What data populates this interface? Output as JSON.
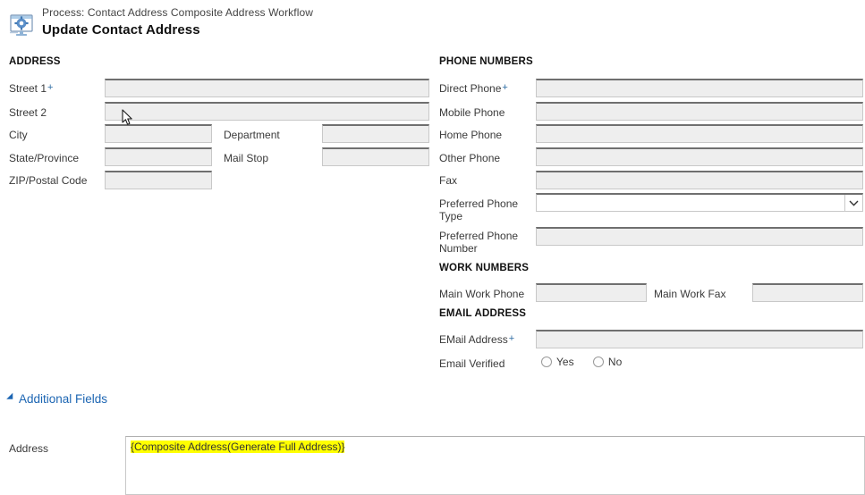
{
  "header": {
    "icon": "workflow-gear-icon",
    "process_line": "Process: Contact Address Composite Address Workflow",
    "title": "Update Contact Address"
  },
  "address_section": {
    "heading": "ADDRESS",
    "fields": [
      {
        "label": "Street 1",
        "required": true,
        "value": "",
        "type": "text"
      },
      {
        "label": "Street 2",
        "required": false,
        "value": "",
        "type": "text"
      },
      {
        "label": "City",
        "required": false,
        "value": "",
        "type": "text"
      },
      {
        "label": "State/Province",
        "required": false,
        "value": "",
        "type": "text"
      },
      {
        "label": "ZIP/Postal Code",
        "required": false,
        "value": "",
        "type": "text"
      }
    ],
    "secondary_fields": [
      {
        "label": "Department",
        "required": false,
        "value": "",
        "type": "text"
      },
      {
        "label": "Mail Stop",
        "required": false,
        "value": "",
        "type": "text"
      }
    ]
  },
  "phone_section": {
    "heading": "PHONE NUMBERS",
    "fields": [
      {
        "label": "Direct Phone",
        "required": true,
        "value": "",
        "type": "text"
      },
      {
        "label": "Mobile Phone",
        "required": false,
        "value": "",
        "type": "text"
      },
      {
        "label": "Home Phone",
        "required": false,
        "value": "",
        "type": "text"
      },
      {
        "label": "Other Phone",
        "required": false,
        "value": "",
        "type": "text"
      },
      {
        "label": "Fax",
        "required": false,
        "value": "",
        "type": "text"
      },
      {
        "label": "Preferred Phone Type",
        "required": false,
        "value": "",
        "type": "select"
      },
      {
        "label": "Preferred Phone Number",
        "required": false,
        "value": "",
        "type": "text"
      }
    ],
    "select_icon": "chevron-down-icon"
  },
  "work_section": {
    "heading": "WORK NUMBERS",
    "fields": [
      {
        "label": "Main Work Phone",
        "required": false,
        "value": "",
        "type": "text"
      },
      {
        "label": "Main Work Fax",
        "required": false,
        "value": "",
        "type": "text"
      }
    ]
  },
  "email_section": {
    "heading": "EMAIL ADDRESS",
    "email_label": "EMail Address",
    "email_required": true,
    "email_value": "",
    "verified_label": "Email Verified",
    "verified_options": [
      {
        "label": "Yes",
        "selected": false
      },
      {
        "label": "No",
        "selected": false
      }
    ]
  },
  "additional_fields": {
    "toggle_label": "Additional Fields",
    "toggle_icon": "triangle-expanded-icon",
    "expanded": true,
    "address_label": "Address",
    "address_token": "{Composite Address(Generate Full Address)}",
    "token_highlight_color": "#ffff00"
  },
  "colors": {
    "link": "#1d66b3",
    "required_marker": "#2e6ca3",
    "field_fill": "#eeeeee",
    "field_border_top": "#6f6f6f",
    "field_border": "#c8c8c8"
  }
}
